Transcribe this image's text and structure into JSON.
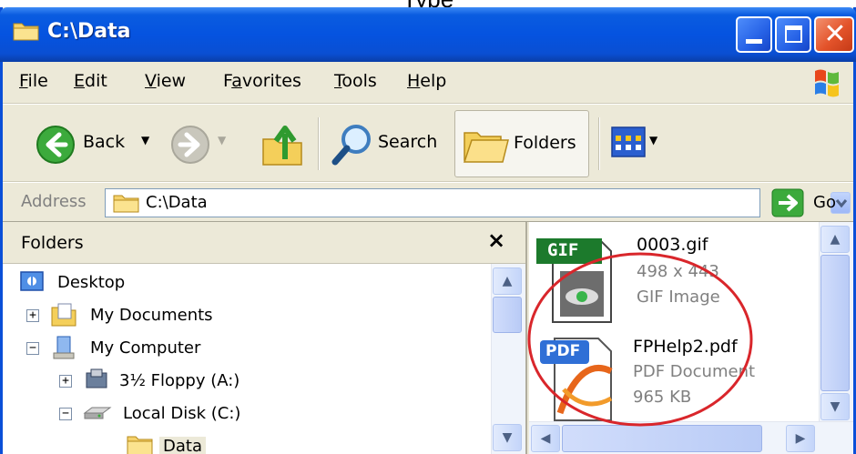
{
  "caption": "Type",
  "window": {
    "title": "C:\\Data",
    "controls": {
      "minimize": "minimize",
      "maximize": "maximize",
      "close": "close"
    }
  },
  "menu": [
    {
      "label": "File",
      "accel": "F",
      "rest": "ile"
    },
    {
      "label": "Edit",
      "accel": "E",
      "rest": "dit"
    },
    {
      "label": "View",
      "accel": "V",
      "rest": "iew"
    },
    {
      "label": "Favorites",
      "accel": "a",
      "pre": "F",
      "rest": "vorites"
    },
    {
      "label": "Tools",
      "accel": "T",
      "rest": "ools"
    },
    {
      "label": "Help",
      "accel": "H",
      "rest": "elp"
    }
  ],
  "toolbar": {
    "back_label": "Back",
    "search_label": "Search",
    "folders_label": "Folders"
  },
  "address": {
    "label": "Address",
    "value": "C:\\Data",
    "go_label": "Go"
  },
  "folders_pane": {
    "title": "Folders",
    "close_glyph": "×",
    "tree": [
      {
        "label": "Desktop",
        "expander": ""
      },
      {
        "label": "My Documents",
        "expander": "+"
      },
      {
        "label": "My Computer",
        "expander": "−"
      },
      {
        "label": "3½ Floppy (A:)",
        "expander": "+"
      },
      {
        "label": "Local Disk (C:)",
        "expander": "−"
      },
      {
        "label": "Data",
        "expander": ""
      }
    ]
  },
  "files": [
    {
      "name": "0003.gif",
      "line1": "498 x 443",
      "line2": "GIF Image",
      "icon": "gif-icon",
      "badge": "GIF"
    },
    {
      "name": "FPHelp2.pdf",
      "line1": "PDF Document",
      "line2": "965 KB",
      "icon": "pdf-icon",
      "badge": "PDF"
    }
  ],
  "colors": {
    "titlebar": "#0553e0",
    "chrome": "#ece9d8",
    "annotation_circle": "#d9262b",
    "close_button": "#e3532a"
  }
}
